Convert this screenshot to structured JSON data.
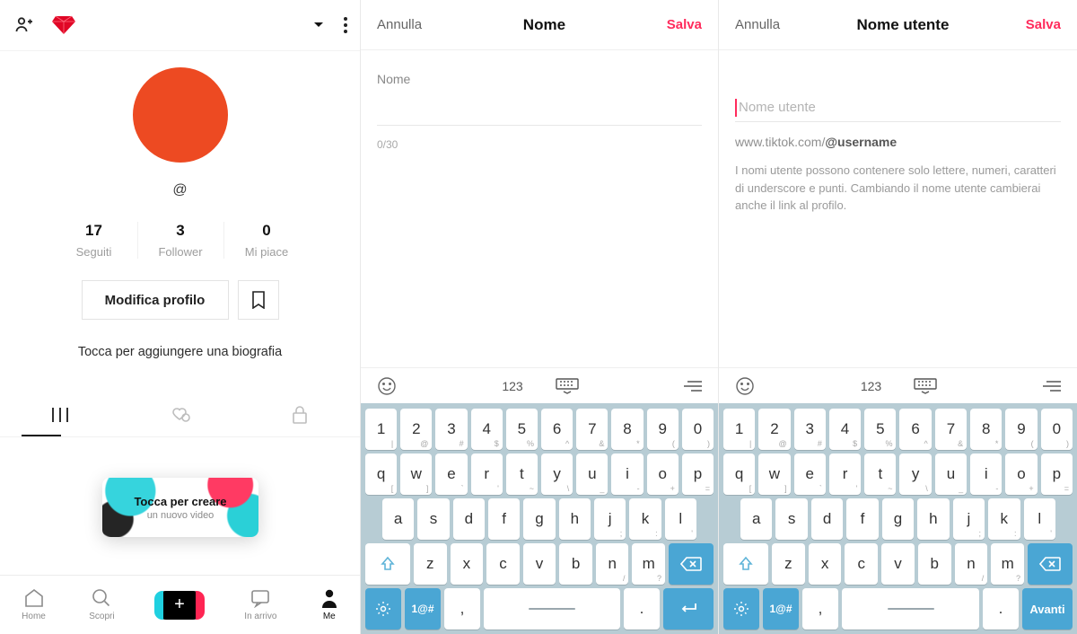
{
  "panel1": {
    "handle": "@",
    "stats": {
      "following": {
        "n": "17",
        "label": "Seguiti"
      },
      "followers": {
        "n": "3",
        "label": "Follower"
      },
      "likes": {
        "n": "0",
        "label": "Mi piace"
      }
    },
    "edit_button": "Modifica profilo",
    "bio_placeholder": "Tocca per aggiungere una biografia",
    "tooltip": {
      "title": "Tocca per creare",
      "sub": "un nuovo video"
    },
    "nav": {
      "home": "Home",
      "discover": "Scopri",
      "inbox": "In arrivo",
      "me": "Me"
    }
  },
  "panel2": {
    "cancel": "Annulla",
    "title": "Nome",
    "save": "Salva",
    "field_label": "Nome",
    "counter": "0/30"
  },
  "panel3": {
    "cancel": "Annulla",
    "title": "Nome utente",
    "save": "Salva",
    "placeholder": "Nome utente",
    "url_prefix": "www.tiktok.com/",
    "url_user": "@username",
    "help": "I nomi utente possono contenere solo lettere, numeri, caratteri di underscore e punti. Cambiando il nome utente cambierai anche il link al profilo."
  },
  "keyboard": {
    "mode_label": "123",
    "row1": [
      {
        "k": "1",
        "s": "|"
      },
      {
        "k": "2",
        "s": "@"
      },
      {
        "k": "3",
        "s": "#"
      },
      {
        "k": "4",
        "s": "$"
      },
      {
        "k": "5",
        "s": "%"
      },
      {
        "k": "6",
        "s": "^"
      },
      {
        "k": "7",
        "s": "&"
      },
      {
        "k": "8",
        "s": "*"
      },
      {
        "k": "9",
        "s": "("
      },
      {
        "k": "0",
        "s": ")"
      }
    ],
    "row2": [
      {
        "k": "q",
        "s": "["
      },
      {
        "k": "w",
        "s": "]"
      },
      {
        "k": "e",
        "s": "`"
      },
      {
        "k": "r",
        "s": "'"
      },
      {
        "k": "t",
        "s": "~"
      },
      {
        "k": "y",
        "s": "\\"
      },
      {
        "k": "u",
        "s": "_"
      },
      {
        "k": "i",
        "s": "-"
      },
      {
        "k": "o",
        "s": "+"
      },
      {
        "k": "p",
        "s": "="
      }
    ],
    "row3": [
      {
        "k": "a",
        "s": ""
      },
      {
        "k": "s",
        "s": ""
      },
      {
        "k": "d",
        "s": ""
      },
      {
        "k": "f",
        "s": ""
      },
      {
        "k": "g",
        "s": ""
      },
      {
        "k": "h",
        "s": ""
      },
      {
        "k": "j",
        "s": ";"
      },
      {
        "k": "k",
        "s": ":"
      },
      {
        "k": "l",
        "s": "'"
      }
    ],
    "row4": [
      {
        "k": "z",
        "s": ""
      },
      {
        "k": "x",
        "s": ""
      },
      {
        "k": "c",
        "s": ""
      },
      {
        "k": "v",
        "s": ""
      },
      {
        "k": "b",
        "s": ""
      },
      {
        "k": "n",
        "s": "/"
      },
      {
        "k": "m",
        "s": "?"
      }
    ],
    "sym_label": "1@#",
    "comma": ",",
    "dot": ".",
    "next_label": "Avanti"
  }
}
